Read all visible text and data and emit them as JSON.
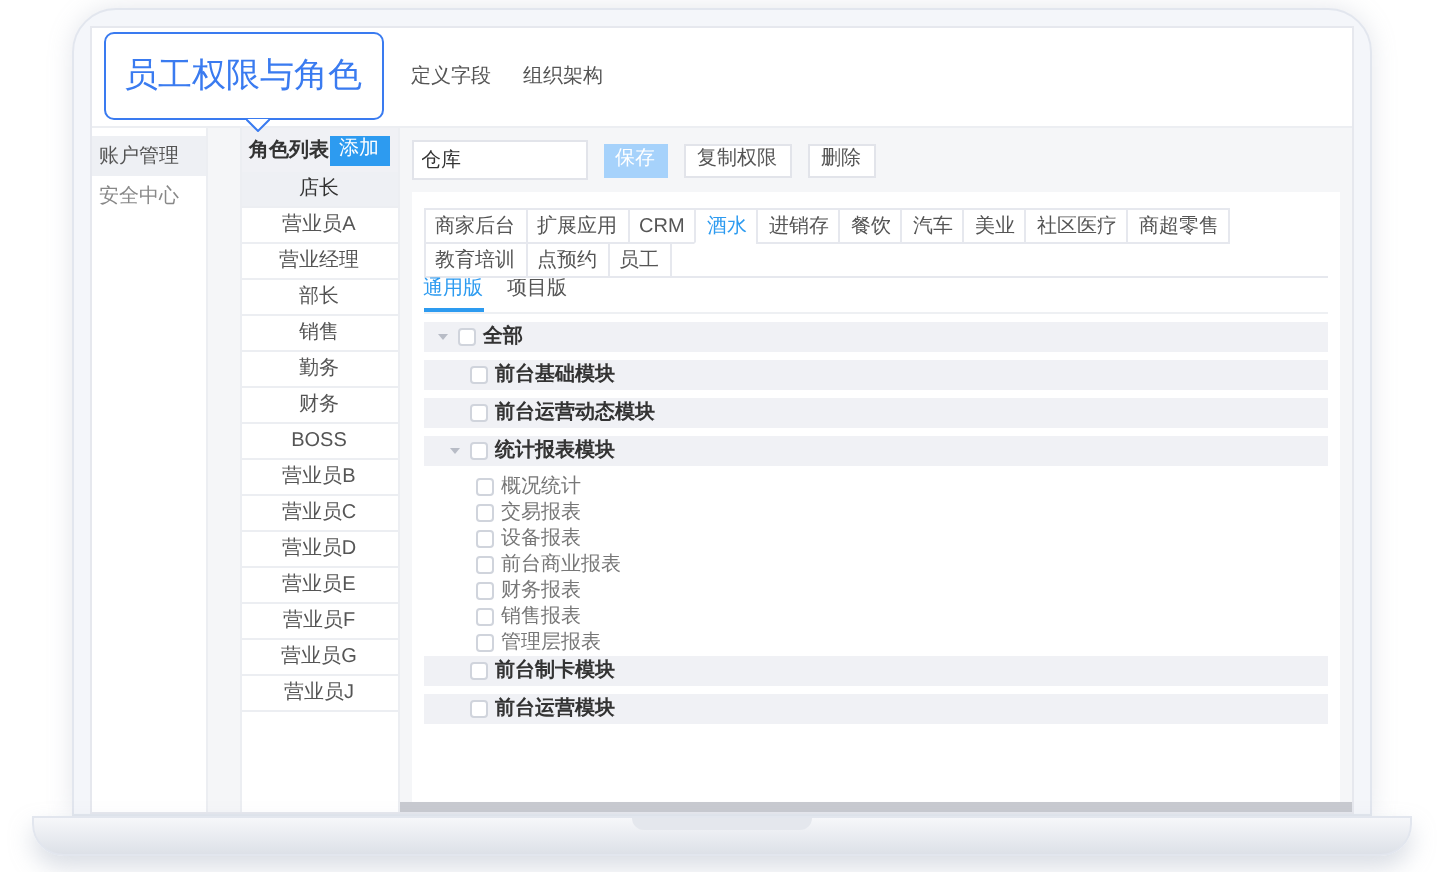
{
  "callout": {
    "text": "员工权限与角色"
  },
  "header_tabs": [
    {
      "label": "定义字段"
    },
    {
      "label": "组织架构"
    }
  ],
  "sidebar": {
    "items": [
      {
        "label": "账户管理",
        "selected": true
      },
      {
        "label": "安全中心",
        "selected": false
      }
    ]
  },
  "roles": {
    "title": "角色列表",
    "add_button": "添加",
    "items": [
      {
        "label": "店长",
        "selected": true
      },
      {
        "label": "营业员A",
        "selected": false
      },
      {
        "label": "营业经理",
        "selected": false
      },
      {
        "label": "部长",
        "selected": false
      },
      {
        "label": "销售",
        "selected": false
      },
      {
        "label": "勤务",
        "selected": false
      },
      {
        "label": "财务",
        "selected": false
      },
      {
        "label": "BOSS",
        "selected": false
      },
      {
        "label": "营业员B",
        "selected": false
      },
      {
        "label": "营业员C",
        "selected": false
      },
      {
        "label": "营业员D",
        "selected": false
      },
      {
        "label": "营业员E",
        "selected": false
      },
      {
        "label": "营业员F",
        "selected": false
      },
      {
        "label": "营业员G",
        "selected": false
      },
      {
        "label": "营业员J",
        "selected": false
      }
    ]
  },
  "toolbar": {
    "role_name": {
      "value": "仓库"
    },
    "buttons": [
      {
        "label": "保存",
        "kind": "primary"
      },
      {
        "label": "复制权限",
        "kind": "default"
      },
      {
        "label": "删除",
        "kind": "default"
      }
    ]
  },
  "industry_tabs": [
    {
      "label": "商家后台",
      "selected": false
    },
    {
      "label": "扩展应用",
      "selected": false
    },
    {
      "label": "CRM",
      "selected": false
    },
    {
      "label": "酒水",
      "selected": true
    },
    {
      "label": "进销存",
      "selected": false
    },
    {
      "label": "餐饮",
      "selected": false
    },
    {
      "label": "汽车",
      "selected": false
    },
    {
      "label": "美业",
      "selected": false
    },
    {
      "label": "社区医疗",
      "selected": false
    },
    {
      "label": "商超零售",
      "selected": false
    },
    {
      "label": "教育培训",
      "selected": false
    },
    {
      "label": "点预约",
      "selected": false
    },
    {
      "label": "员工",
      "selected": false
    }
  ],
  "edition_tabs": [
    {
      "label": "通用版",
      "selected": true
    },
    {
      "label": "项目版",
      "selected": false
    }
  ],
  "permission_tree": [
    {
      "label": "全部",
      "checked": false,
      "expanded": true,
      "children": [
        {
          "label": "前台基础模块",
          "checked": false
        },
        {
          "label": "前台运营动态模块",
          "checked": false
        },
        {
          "label": "统计报表模块",
          "checked": false,
          "expanded": true,
          "children": [
            {
              "label": "概况统计",
              "checked": false
            },
            {
              "label": "交易报表",
              "checked": false
            },
            {
              "label": "设备报表",
              "checked": false
            },
            {
              "label": "前台商业报表",
              "checked": false
            },
            {
              "label": "财务报表",
              "checked": false
            },
            {
              "label": "销售报表",
              "checked": false
            },
            {
              "label": "管理层报表",
              "checked": false
            }
          ]
        },
        {
          "label": "前台制卡模块",
          "checked": false
        },
        {
          "label": "前台运营模块",
          "checked": false
        }
      ]
    }
  ]
}
